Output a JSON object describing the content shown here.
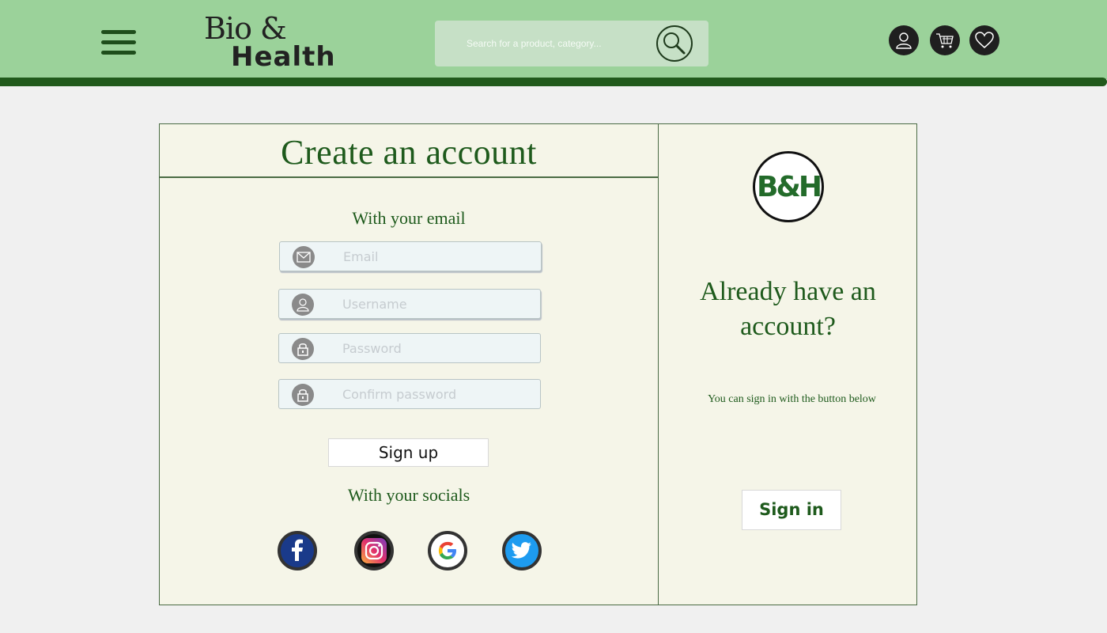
{
  "header": {
    "logo_line1": "Bio &",
    "logo_line2": "Health",
    "search_placeholder": "Search for a product, category...",
    "icons": [
      "account-icon",
      "cart-icon",
      "heart-icon"
    ]
  },
  "register": {
    "title": "Create an account",
    "email_section": "With your email",
    "fields": {
      "email_placeholder": "Email",
      "username_placeholder": "Username",
      "password_placeholder": "Password",
      "confirm_placeholder": "Confirm password"
    },
    "signup_label": "Sign up",
    "socials_section": "With your socials",
    "socials": [
      "facebook",
      "instagram",
      "google",
      "twitter"
    ]
  },
  "login": {
    "logo_text": "B&H",
    "heading": "Already have an account?",
    "hint": "You can sign in with the button below",
    "signin_label": "Sign in"
  },
  "colors": {
    "header_bg": "#9bd29a",
    "header_bar": "#215a1c",
    "accent_green": "#1e5a1c",
    "card_bg": "#f5f5e8"
  }
}
